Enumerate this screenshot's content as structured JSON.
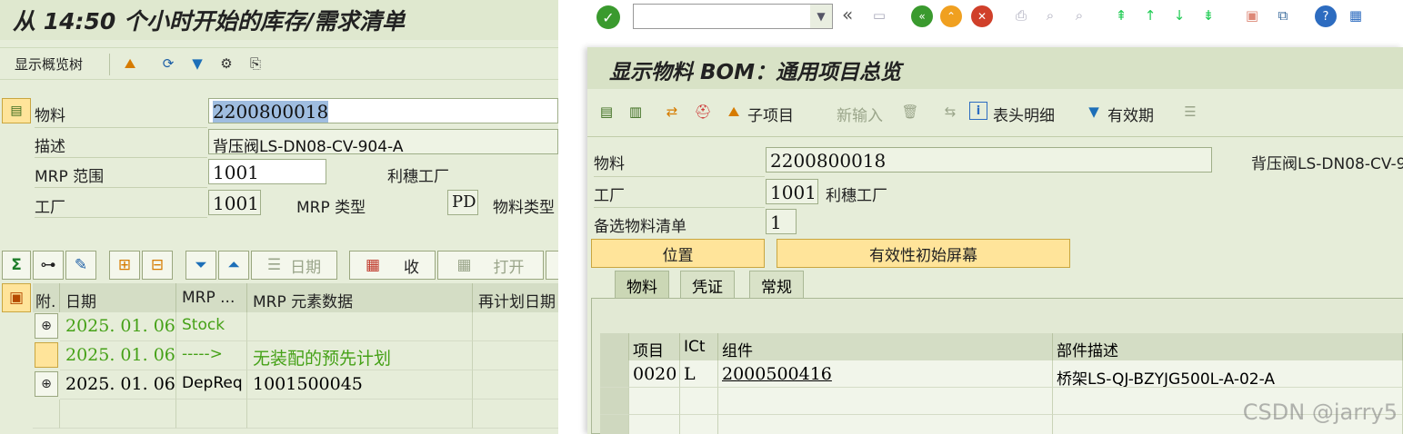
{
  "left": {
    "title": "从 14:50 个小时开始的库存/需求清单",
    "toolbar": {
      "show_tree": "显示概览树"
    },
    "header": {
      "material_label": "物料",
      "material_value": "2200800018",
      "desc_label": "描述",
      "desc_value": "背压阀LS-DN08-CV-904-A",
      "mrp_area_label": "MRP 范围",
      "mrp_area_value": "1001",
      "mrp_area_text": "利穗工厂",
      "plant_label": "工厂",
      "plant_value": "1001",
      "mrp_type_label": "MRP 类型",
      "mrp_type_value": "PD",
      "mat_type_label": "物料类型"
    },
    "buttons": {
      "date": "日期",
      "receipt": "收",
      "open": "打开"
    },
    "grid": {
      "headers": [
        "附.",
        "日期",
        "MRP ...",
        "MRP 元素数据",
        "再计划日期"
      ],
      "rows": [
        {
          "date": "2025. 01. 06",
          "element": "Stock",
          "data": ""
        },
        {
          "date": "2025. 01. 06",
          "element": "----->",
          "data": "无装配的预先计划"
        },
        {
          "date": "2025. 01. 06",
          "element": "DepReq",
          "data": "1001500045"
        }
      ]
    }
  },
  "right": {
    "title": "显示物料 BOM：通用项目总览",
    "sys_toolbar": {
      "command_value": "",
      "back_glyph": "«"
    },
    "app_toolbar": {
      "subitem": "子项目",
      "new_entry": "新输入",
      "header_detail": "表头明细",
      "validity": "有效期"
    },
    "form": {
      "material_label": "物料",
      "material_value": "2200800018",
      "material_desc": "背压阀LS-DN08-CV-9",
      "plant_label": "工厂",
      "plant_value": "1001",
      "plant_text": "利穗工厂",
      "alt_bom_label": "备选物料清单",
      "alt_bom_value": "1"
    },
    "buttons": {
      "position": "位置",
      "validity_init": "有效性初始屏幕"
    },
    "tabs": [
      "物料",
      "凭证",
      "常规"
    ],
    "grid": {
      "headers": [
        "项目",
        "ICt",
        "组件",
        "部件描述"
      ],
      "rows": [
        {
          "item": "0020",
          "ict": "L",
          "component": "2000500416",
          "desc": "桥架LS-QJ-BZYJG500L-A-02-A"
        }
      ]
    },
    "watermark": "CSDN @jarry5"
  }
}
